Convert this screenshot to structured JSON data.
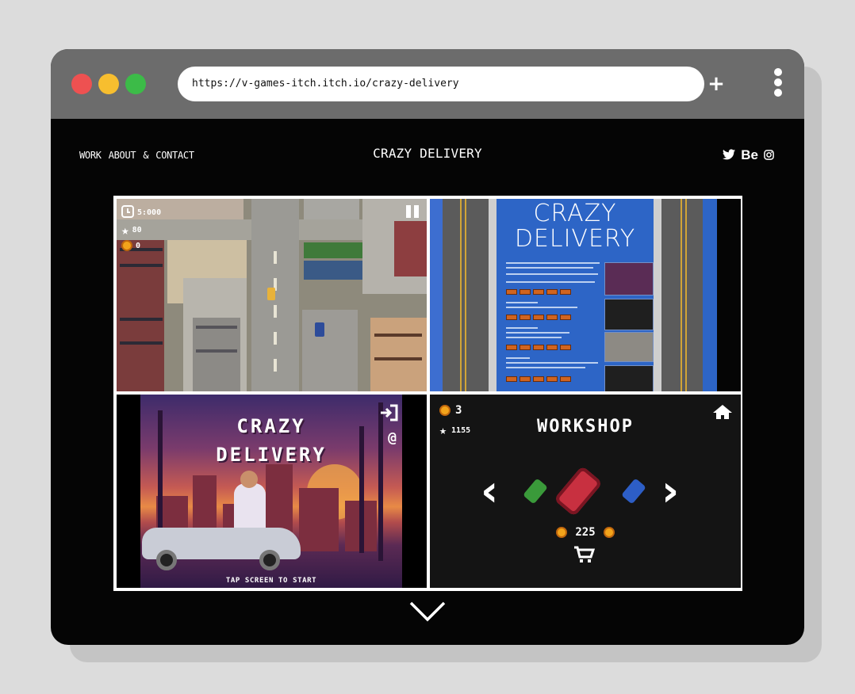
{
  "browser": {
    "url": "https://v-games-itch.itch.io/crazy-delivery",
    "new_tab_label": "+"
  },
  "site": {
    "nav": [
      "WORK",
      "ABOUT",
      "&",
      "CONTACT"
    ],
    "title": "CRAZY DELIVERY",
    "social": {
      "twitter_icon": "twitter-bird-icon",
      "behance_label": "Be",
      "instagram_icon": "instagram-icon"
    }
  },
  "gallery": {
    "tile1": {
      "hud_time": "5:000",
      "hud_stars": "80",
      "hud_coins": "0"
    },
    "tile2": {
      "page_title_line1": "CRAZY",
      "page_title_line2": "DELIVERY"
    },
    "tile3": {
      "title_line1": "CRAZY",
      "title_line2": "DELIVERY",
      "tap_to_start": "TAP SCREEN TO START",
      "at_symbol": "@"
    },
    "tile4": {
      "coins": "3",
      "stars": "1155",
      "title": "WORKSHOP",
      "price": "225"
    }
  },
  "scroll": {
    "icon": "chevron-down-icon"
  },
  "colors": {
    "traffic_red": "#ee5151",
    "traffic_yellow": "#f7be2f",
    "traffic_green": "#3cbb48",
    "titlebar": "#6c6c6c",
    "window_bg": "#050505",
    "itch_blue": "#2d65c6",
    "coin": "#f3a41b"
  }
}
